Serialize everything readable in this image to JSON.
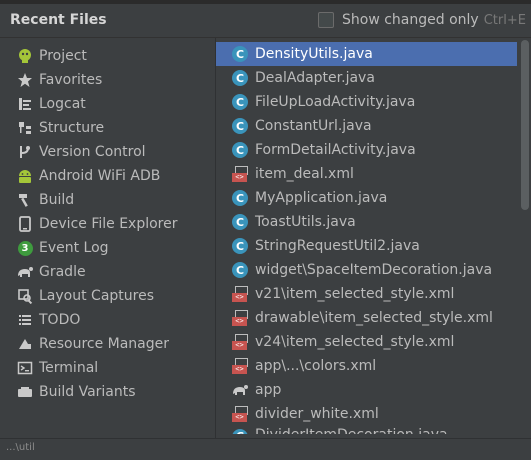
{
  "header": {
    "title": "Recent Files",
    "show_changed_label": "Show changed only",
    "shortcut": "Ctrl+E",
    "show_changed_checked": false
  },
  "toolwindows": [
    {
      "label": "Project",
      "icon": "android-icon"
    },
    {
      "label": "Favorites",
      "icon": "star-icon"
    },
    {
      "label": "Logcat",
      "icon": "logcat-icon"
    },
    {
      "label": "Structure",
      "icon": "structure-icon"
    },
    {
      "label": "Version Control",
      "icon": "vcs-icon"
    },
    {
      "label": "Android WiFi ADB",
      "icon": "android-wifi-icon"
    },
    {
      "label": "Build",
      "icon": "hammer-icon"
    },
    {
      "label": "Device File Explorer",
      "icon": "device-icon"
    },
    {
      "label": "Event Log",
      "icon": "event-log-icon"
    },
    {
      "label": "Gradle",
      "icon": "gradle-icon"
    },
    {
      "label": "Layout Captures",
      "icon": "layout-captures-icon"
    },
    {
      "label": "TODO",
      "icon": "todo-icon"
    },
    {
      "label": "Resource Manager",
      "icon": "resource-manager-icon"
    },
    {
      "label": "Terminal",
      "icon": "terminal-icon"
    },
    {
      "label": "Build Variants",
      "icon": "build-variants-icon"
    }
  ],
  "event_log_badge": "3",
  "files": [
    {
      "name": "DensityUtils.java",
      "type": "java",
      "selected": true
    },
    {
      "name": "DealAdapter.java",
      "type": "java"
    },
    {
      "name": "FileUpLoadActivity.java",
      "type": "java"
    },
    {
      "name": "ConstantUrl.java",
      "type": "java"
    },
    {
      "name": "FormDetailActivity.java",
      "type": "java"
    },
    {
      "name": "item_deal.xml",
      "type": "xml"
    },
    {
      "name": "MyApplication.java",
      "type": "java"
    },
    {
      "name": "ToastUtils.java",
      "type": "java"
    },
    {
      "name": "StringRequestUtil2.java",
      "type": "java"
    },
    {
      "name": "widget\\SpaceItemDecoration.java",
      "type": "java"
    },
    {
      "name": "v21\\item_selected_style.xml",
      "type": "xml"
    },
    {
      "name": "drawable\\item_selected_style.xml",
      "type": "xml"
    },
    {
      "name": "v24\\item_selected_style.xml",
      "type": "xml"
    },
    {
      "name": "app\\...\\colors.xml",
      "type": "xml"
    },
    {
      "name": "app",
      "type": "gradle"
    },
    {
      "name": "divider_white.xml",
      "type": "xml"
    },
    {
      "name": "DividerItemDecoration.java",
      "type": "java",
      "partial": true
    }
  ],
  "java_glyph": "C",
  "xml_glyph": "<>",
  "status": {
    "path": "...\\util"
  },
  "colors": {
    "background": "#3c3f41",
    "selection": "#4b6eaf",
    "java_icon": "#3a94bb",
    "xml_icon": "#c75450",
    "android_green": "#a4c639"
  }
}
